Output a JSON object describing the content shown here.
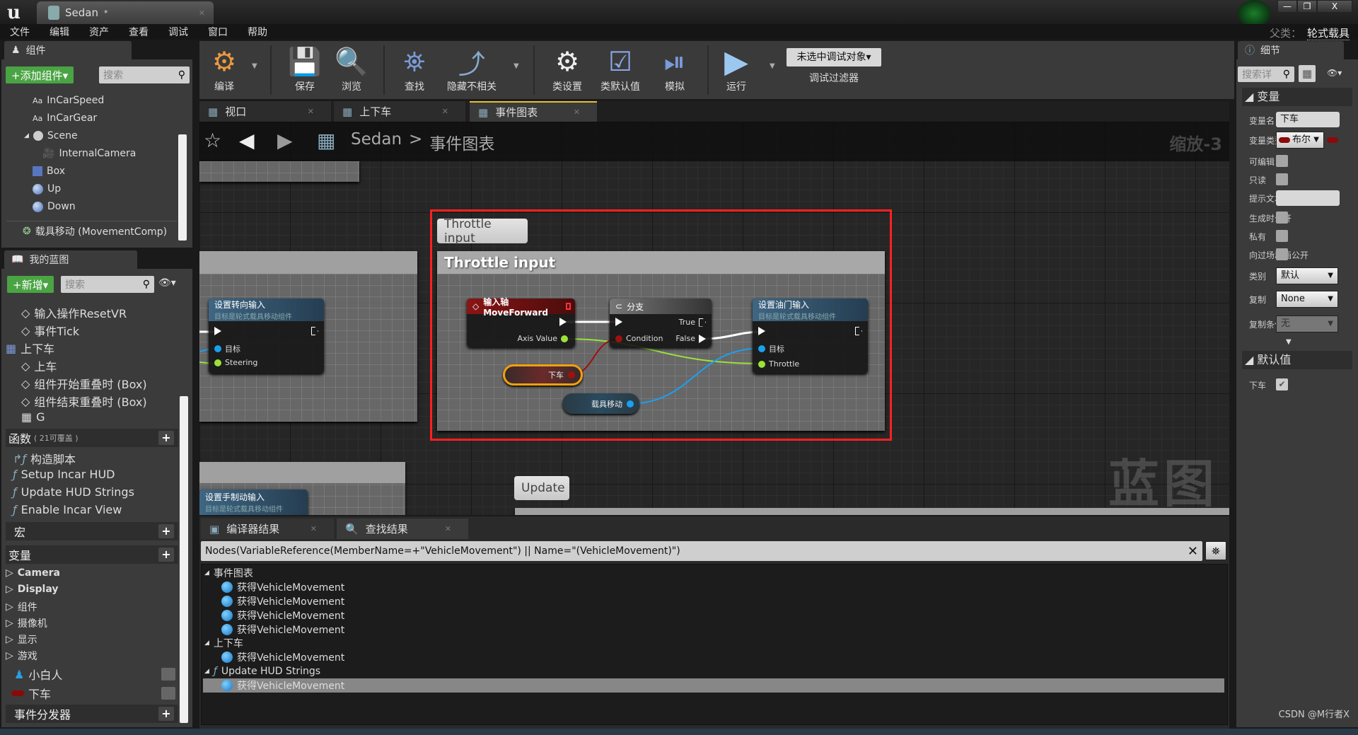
{
  "window": {
    "tab_title": "Sedan",
    "modified_mark": "*",
    "parent_label": "父类：",
    "parent_value": "轮式载具",
    "controls": [
      "—",
      "❐",
      "X"
    ]
  },
  "menu": [
    "文件",
    "编辑",
    "资产",
    "查看",
    "调试",
    "窗口",
    "帮助"
  ],
  "components": {
    "tab": "组件",
    "add_button": "+添加组件▾",
    "search_placeholder": "搜索",
    "items": [
      "InCarSpeed",
      "InCarGear",
      "Scene",
      "InternalCamera",
      "Box",
      "Up",
      "Down"
    ],
    "movement": "载具移动 (MovementComp)"
  },
  "my_blueprint": {
    "tab": "我的蓝图",
    "new_button": "+新增▾",
    "search_placeholder": "搜索",
    "graph_items": [
      "输入操作ResetVR",
      "事件Tick"
    ],
    "group": "上下车",
    "group_items": [
      "上车",
      "组件开始重叠时 (Box)",
      "组件结束重叠时 (Box)",
      "G"
    ],
    "functions_label": "函数",
    "functions_note": "( 21可覆盖 )",
    "functions": [
      "构造脚本",
      "Setup Incar HUD",
      "Update HUD Strings",
      "Enable Incar View"
    ],
    "macros_label": "宏",
    "variables_label": "变量",
    "var_categories": [
      "Camera",
      "Display",
      "组件",
      "摄像机",
      "显示",
      "游戏"
    ],
    "variables": [
      "小白人",
      "下车"
    ],
    "dispatchers_label": "事件分发器"
  },
  "toolbar": {
    "buttons": [
      "编译",
      "保存",
      "浏览",
      "查找",
      "隐藏不相关",
      "类设置",
      "类默认值",
      "模拟",
      "运行"
    ],
    "debug_select": "未选中调试对象▾",
    "debug_label": "调试过滤器"
  },
  "graph_tabs": [
    "视口",
    "上下车",
    "事件图表"
  ],
  "breadcrumb": {
    "root": "Sedan",
    "separator": ">",
    "current": "事件图表"
  },
  "zoom_label": "缩放-3",
  "watermark": "蓝图",
  "graph": {
    "bubble": "Throttle input",
    "comment_title": "Throttle input",
    "update_bubble": "Update",
    "axis_node": {
      "title": "输入轴MoveForward",
      "pin": "Axis Value"
    },
    "branch_node": {
      "title": "分支",
      "condition": "Condition",
      "true": "True",
      "false": "False"
    },
    "throttle_node": {
      "title": "设置油门输入",
      "subtitle": "目标是轮式载具移动组件",
      "target": "目标",
      "throttle": "Throttle"
    },
    "steering_node": {
      "title": "设置转向输入",
      "subtitle": "目标是轮式载具移动组件",
      "target": "目标",
      "steering": "Steering"
    },
    "handbrake_node": {
      "title": "设置手制动输入",
      "subtitle": "目标是轮式载具移动组件"
    },
    "var_getter": "下车",
    "movement_getter": "载具移动",
    "colors": {
      "exec": "#ffffff",
      "float": "#9be33a",
      "bool": "#a01010",
      "object": "#1aa0f0",
      "highlight": "#ff2020"
    }
  },
  "bottom": {
    "tabs": [
      "编译器结果",
      "查找结果"
    ],
    "query": "Nodes(VariableReference(MemberName=+\"VehicleMovement\") || Name=\"(VehicleMovement)\")",
    "groups": [
      {
        "label": "事件图表",
        "items": [
          "获得VehicleMovement",
          "获得VehicleMovement",
          "获得VehicleMovement",
          "获得VehicleMovement"
        ]
      },
      {
        "label": "上下车",
        "items": [
          "获得VehicleMovement"
        ]
      },
      {
        "label": "Update HUD Strings",
        "items": [
          "获得VehicleMovement"
        ]
      }
    ]
  },
  "details": {
    "tab": "细节",
    "search_placeholder": "搜索详",
    "variables_section": "变量",
    "rows": [
      "变量名",
      "变量类型",
      "可编辑",
      "只读",
      "提示文本",
      "生成时公开",
      "私有",
      "向过场动画公开",
      "类别",
      "复制",
      "复制条件"
    ],
    "name_value": "下车",
    "type_value": "布尔",
    "category_value": "默认",
    "replication_value": "None",
    "rep_condition_value": "无",
    "defaults_section": "默认值",
    "default_label": "下车",
    "default_checked": true
  },
  "credit": "CSDN @M行者X"
}
